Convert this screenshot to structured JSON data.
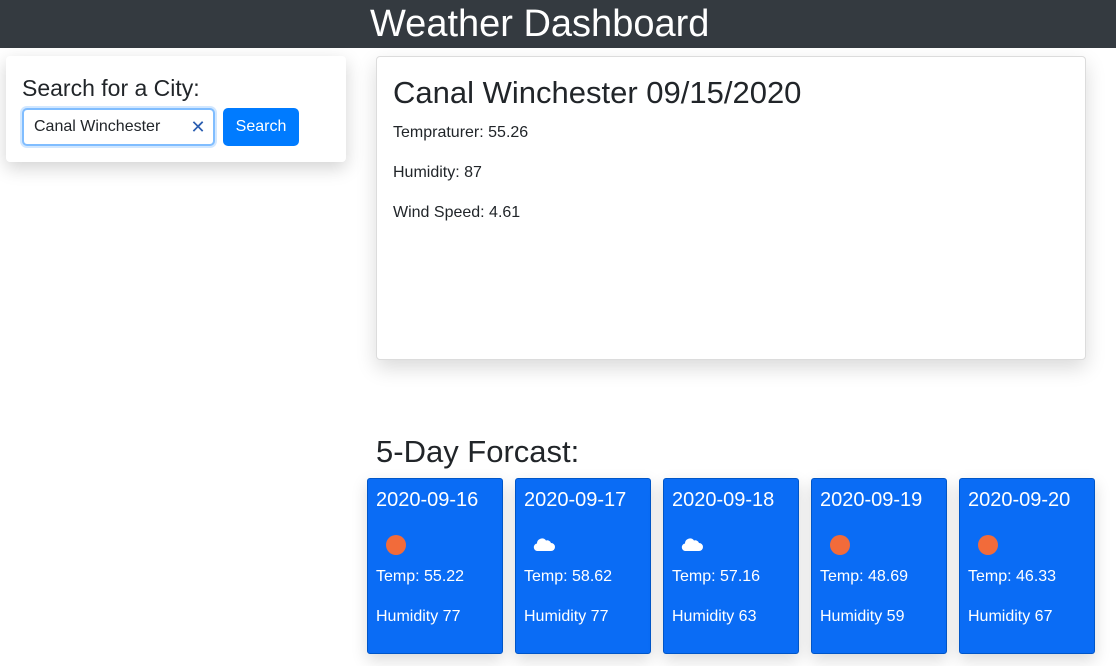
{
  "header": {
    "title": "Weather Dashboard"
  },
  "search": {
    "label": "Search for a City:",
    "value": "Canal Winchester",
    "button_label": "Search"
  },
  "current": {
    "title": "Canal Winchester 09/15/2020",
    "temperature": "Tempraturer: 55.26",
    "humidity": "Humidity: 87",
    "wind": "Wind Speed: 4.61"
  },
  "forecast": {
    "heading": "5-Day Forcast:",
    "days": [
      {
        "date": "2020-09-16",
        "icon": "sun-icon",
        "temp": "Temp: 55.22",
        "humidity": "Humidity 77"
      },
      {
        "date": "2020-09-17",
        "icon": "cloud-icon",
        "temp": "Temp: 58.62",
        "humidity": "Humidity 77"
      },
      {
        "date": "2020-09-18",
        "icon": "cloud-icon",
        "temp": "Temp: 57.16",
        "humidity": "Humidity 63"
      },
      {
        "date": "2020-09-19",
        "icon": "sun-icon",
        "temp": "Temp: 48.69",
        "humidity": "Humidity 59"
      },
      {
        "date": "2020-09-20",
        "icon": "sun-icon",
        "temp": "Temp: 46.33",
        "humidity": "Humidity 67"
      }
    ]
  },
  "colors": {
    "header_bg": "#343a40",
    "accent": "#007bff",
    "card_blue": "#0a6cf5",
    "sun": "#f26b3a"
  }
}
